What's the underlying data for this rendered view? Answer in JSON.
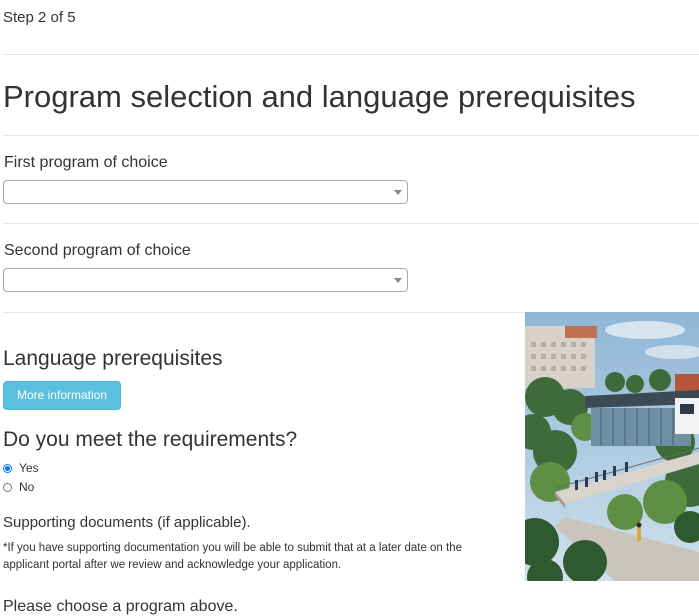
{
  "step": {
    "label": "Step 2 of 5"
  },
  "page": {
    "title": "Program selection and language prerequisites"
  },
  "first_program": {
    "label": "First program of choice",
    "selected": ""
  },
  "second_program": {
    "label": "Second program of choice",
    "selected": ""
  },
  "language": {
    "title": "Language prerequisites",
    "more_info_label": "More information",
    "question": "Do you meet the requirements?",
    "options": [
      {
        "label": "Yes",
        "checked": true
      },
      {
        "label": "No",
        "checked": false
      }
    ]
  },
  "supporting": {
    "title": "Supporting documents (if applicable).",
    "note": "*If you have supporting documentation you will be able to submit that at a later date on the applicant portal after we review and acknowledge your application."
  },
  "footer": {
    "message": "Please choose a program above."
  },
  "colors": {
    "info_button": "#5bc0de",
    "radio_accent": "#0075ff",
    "divider": "#e5e5e5"
  }
}
